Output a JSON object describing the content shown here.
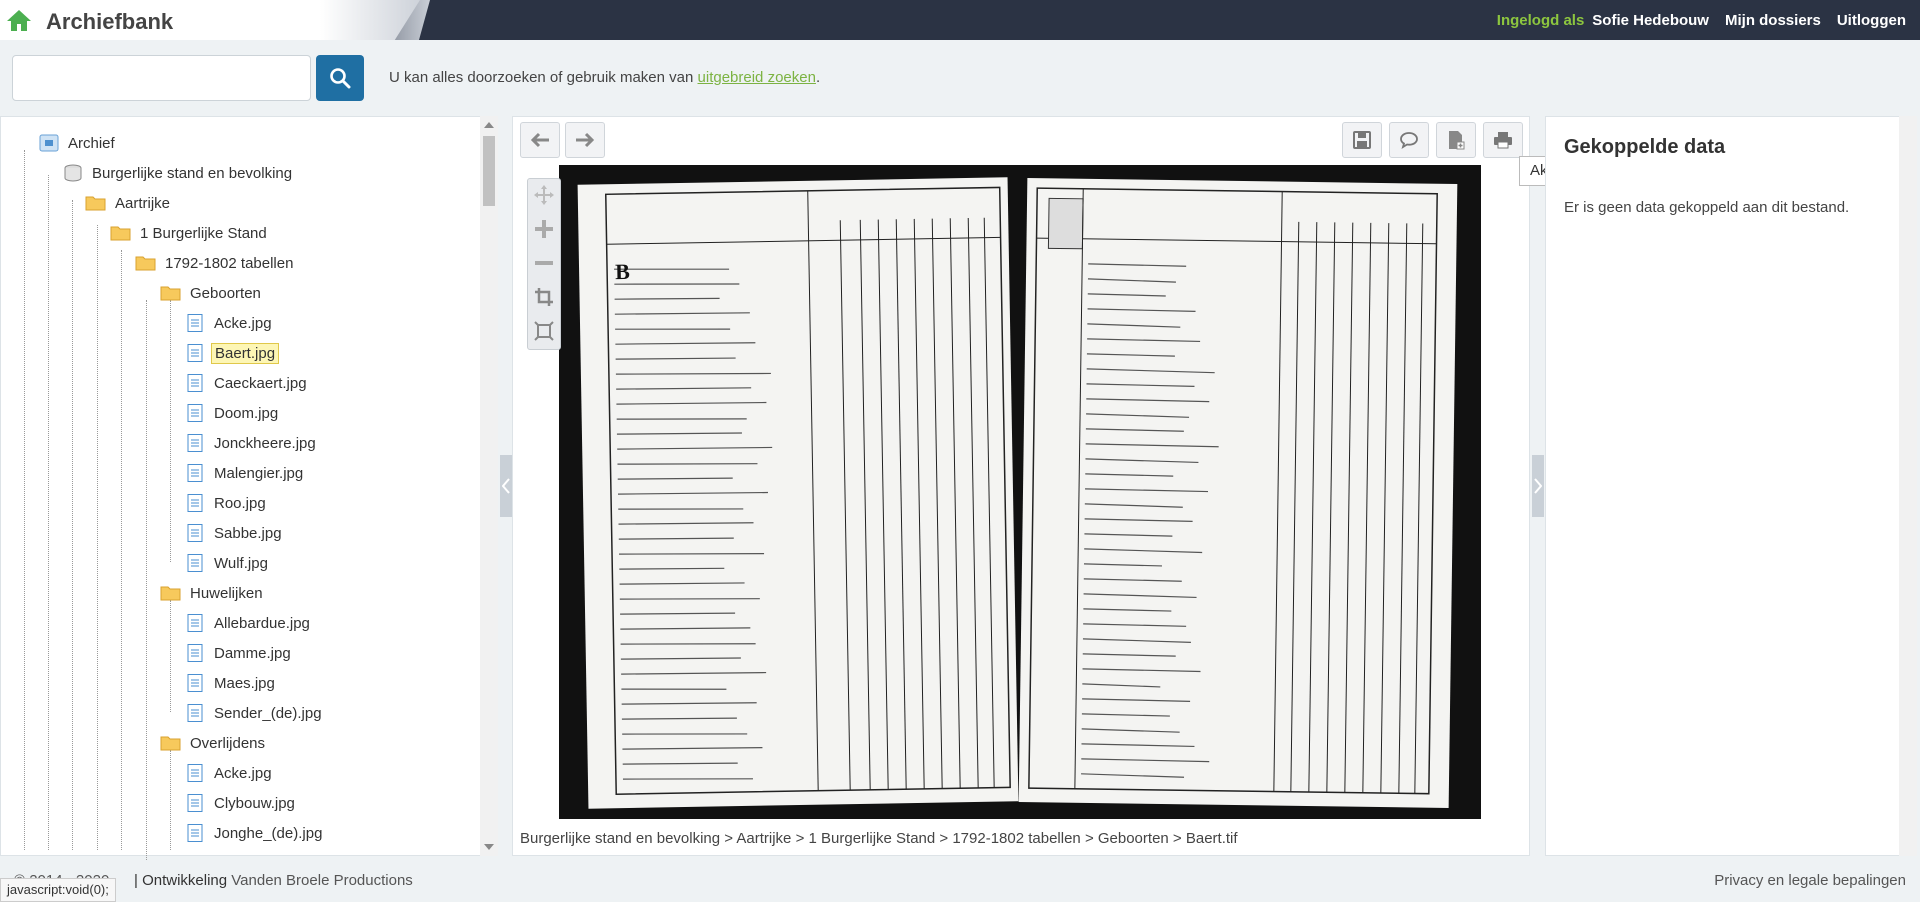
{
  "header": {
    "brand": "Archiefbank",
    "logged_in_label": "Ingelogd als",
    "user_name": "Sofie Hedebouw",
    "my_dossiers": "Mijn dossiers",
    "logout": "Uitloggen"
  },
  "search": {
    "value": "",
    "placeholder": "",
    "hint_prefix": "U kan alles doorzoeken of gebruik maken van ",
    "hint_link": "uitgebreid zoeken",
    "hint_suffix": "."
  },
  "tree": {
    "root": "Archief",
    "n1": "Burgerlijke stand en bevolking",
    "n2": "Aartrijke",
    "n3": "1 Burgerlijke Stand",
    "n4": "1792-1802 tabellen",
    "geboorten": "Geboorten",
    "geboorten_files": [
      "Acke.jpg",
      "Baert.jpg",
      "Caeckaert.jpg",
      "Doom.jpg",
      "Jonckheere.jpg",
      "Malengier.jpg",
      "Roo.jpg",
      "Sabbe.jpg",
      "Wulf.jpg"
    ],
    "huwelijken": "Huwelijken",
    "huwelijken_files": [
      "Allebardue.jpg",
      "Damme.jpg",
      "Maes.jpg",
      "Sender_(de).jpg"
    ],
    "overlijdens": "Overlijdens",
    "overlijdens_files": [
      "Acke.jpg",
      "Clybouw.jpg",
      "Jonghe_(de).jpg"
    ]
  },
  "viewer": {
    "tooltip": "Akte printen",
    "path": "Burgerlijke stand en bevolking > Aartrijke > 1 Burgerlijke Stand > 1792-1802 tabellen > Geboorten > Baert.tif"
  },
  "linked": {
    "title": "Gekoppelde data",
    "empty_text": "Er is geen data gekoppeld aan dit bestand."
  },
  "footer": {
    "copyright": "© 2014 - 2020",
    "dev_label": "| Ontwikkeling",
    "dev_name": "Vanden Broele Productions",
    "privacy": "Privacy en legale bepalingen",
    "status": "javascript:void(0);"
  },
  "colors": {
    "header_bg": "#2b3344",
    "accent_green": "#8dc63f",
    "search_btn": "#1f6fa3"
  }
}
